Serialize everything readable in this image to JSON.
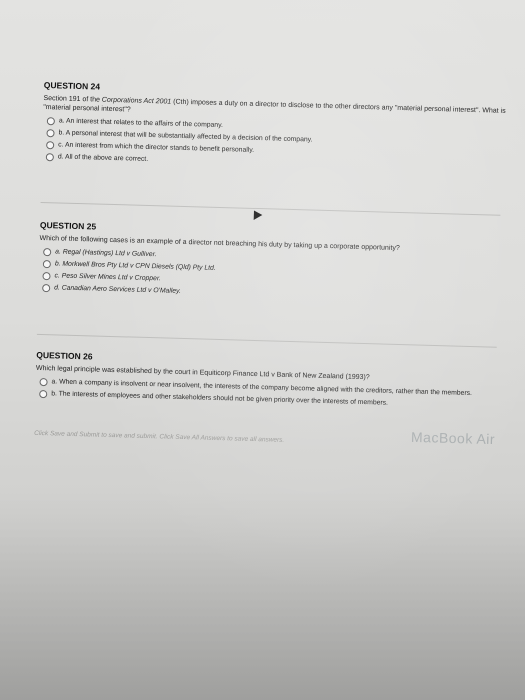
{
  "q24": {
    "title": "QUESTION 24",
    "text_pre": "Section 191 of the ",
    "text_act": "Corporations Act 2001",
    "text_post": " (Cth) imposes a duty on a director to disclose to the other directors any \"material personal interest\". What is \"material personal interest\"?",
    "options": [
      "a. An interest that relates to the affairs of the company.",
      "b. A personal interest that will be substantially affected by a decision of the company.",
      "c. An interest from which the director stands to benefit personally.",
      "d. All of the above are correct."
    ]
  },
  "q25": {
    "title": "QUESTION 25",
    "text": "Which of the following cases is an example of a director not breaching his duty by taking up a corporate opportunity?",
    "options": [
      "a. Regal (Hastings) Ltd v Gulliver.",
      "b. Morkwell Bros Pty Ltd v CPN Diesels (Qld) Pty Ltd.",
      "c. Peso Silver Mines Ltd v Cropper.",
      "d. Canadian Aero Services Ltd v O'Malley."
    ]
  },
  "q26": {
    "title": "QUESTION 26",
    "text": "Which legal principle was established by the court in Equiticorp Finance Ltd v Bank of New Zealand (1993)?",
    "options": [
      "a. When a company is insolvent or near insolvent, the interests of the company become aligned with the creditors, rather than the members.",
      "b. The interests of employees and other stakeholders should not be given priority over the interests of members."
    ]
  },
  "footer": "Click Save and Submit to save and submit. Click Save All Answers to save all answers.",
  "watermark": "MacBook Air"
}
